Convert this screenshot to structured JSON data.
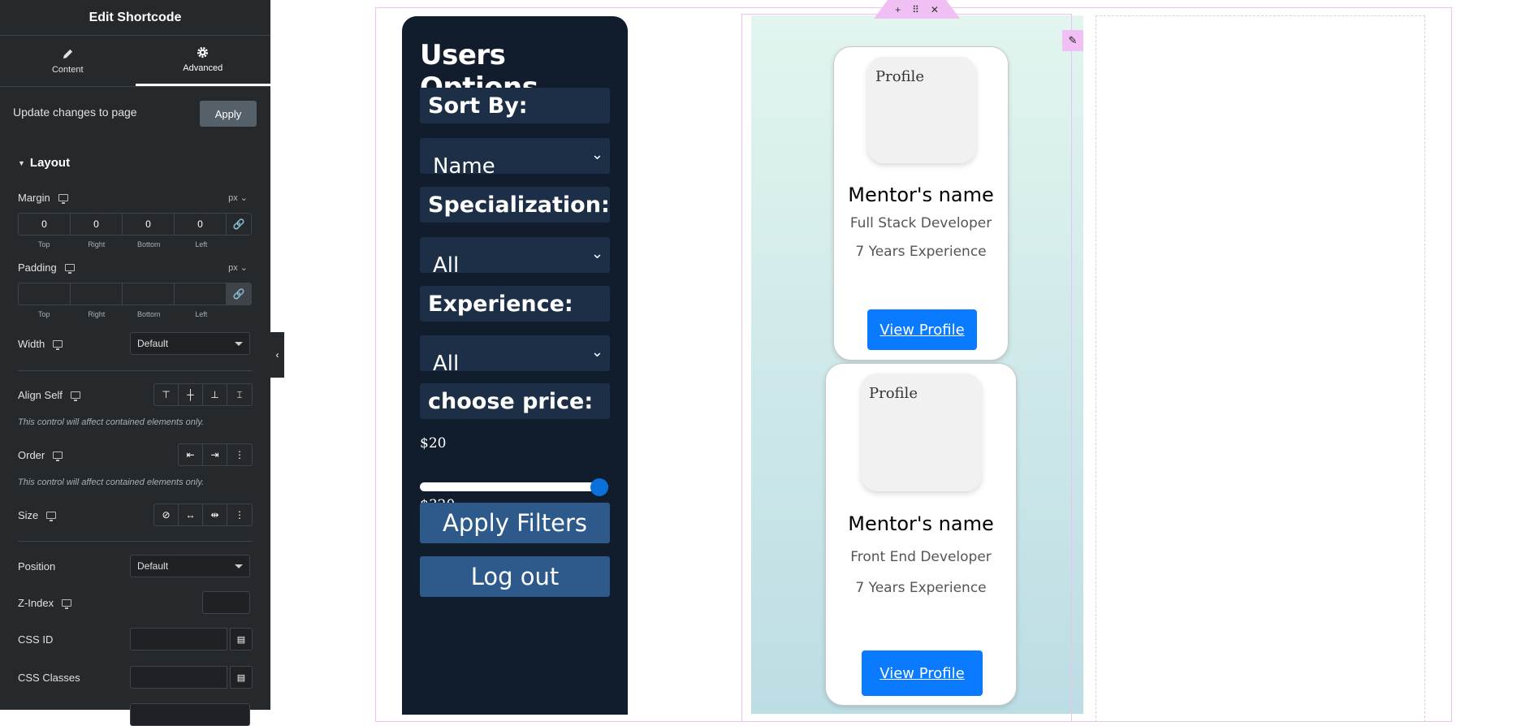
{
  "panel": {
    "title": "Edit Shortcode",
    "tabs": [
      {
        "label": "Content",
        "icon": "pencil-icon"
      },
      {
        "label": "Advanced",
        "icon": "gear-icon"
      }
    ],
    "update_text": "Update changes to page",
    "apply_label": "Apply",
    "section_title": "Layout",
    "margin": {
      "label": "Margin",
      "unit": "px",
      "values": [
        "0",
        "0",
        "0",
        "0"
      ],
      "sublabels": [
        "Top",
        "Right",
        "Bottom",
        "Left"
      ]
    },
    "padding": {
      "label": "Padding",
      "unit": "px",
      "values": [
        "",
        "",
        "",
        ""
      ],
      "sublabels": [
        "Top",
        "Right",
        "Bottom",
        "Left"
      ]
    },
    "width": {
      "label": "Width",
      "value": "Default"
    },
    "align_self": {
      "label": "Align Self",
      "note": "This control will affect contained elements only."
    },
    "order": {
      "label": "Order",
      "note": "This control will affect contained elements only."
    },
    "size": {
      "label": "Size"
    },
    "position": {
      "label": "Position",
      "value": "Default"
    },
    "zindex": {
      "label": "Z-Index"
    },
    "css_id": {
      "label": "CSS ID"
    },
    "css_classes": {
      "label": "CSS Classes"
    }
  },
  "filters": {
    "title": "Users Options",
    "sort_label": "Sort By:",
    "sort_value": "Name",
    "spec_label": "Specialization:",
    "spec_value": "All",
    "exp_label": "Experience:",
    "exp_value": "All",
    "price_label": "choose price:",
    "price_min": "$20",
    "price_max": "$320",
    "price_slider_fraction": 1.0,
    "apply_label": "Apply Filters",
    "logout_label": "Log out"
  },
  "mentors": [
    {
      "img_alt": "Profile",
      "name": "Mentor's name",
      "role": "Full Stack Developer",
      "experience": "7 Years Experience",
      "button": "View Profile"
    },
    {
      "img_alt": "Profile",
      "name": "Mentor's name",
      "role": "Front End Developer",
      "experience": "7 Years Experience",
      "button": "View Profile"
    }
  ],
  "colors": {
    "panel_bg": "#26292c",
    "filters_bg": "#111d2c",
    "accent_blue": "#0a7bff",
    "outline": "#f0c0f4"
  }
}
